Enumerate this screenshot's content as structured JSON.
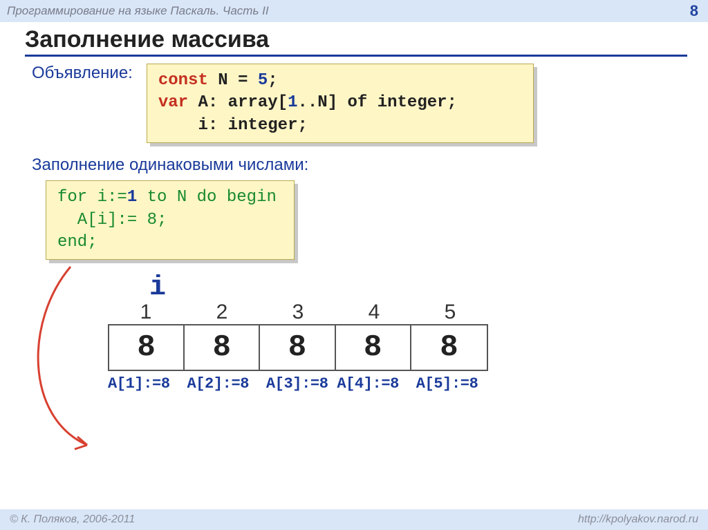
{
  "header": {
    "title": "Программирование на языке Паскаль. Часть II",
    "page": "8"
  },
  "title": "Заполнение массива",
  "section1_label": "Объявление:",
  "code1": {
    "l1a": "const",
    "l1b": " N = ",
    "l1c": "5",
    "l1d": ";",
    "l2a": "var",
    "l2b": " A: array[",
    "l2c": "1",
    "l2d": "..N] of integer;",
    "l3": "    i: integer;"
  },
  "section2_label": "Заполнение одинаковыми числами:",
  "code2": {
    "l1a": "for i:=",
    "l1b": "1",
    "l1c": " to N do begin",
    "l2": "  A[i]:= 8;",
    "l3": "end;"
  },
  "diagram": {
    "index_var": "i",
    "indices": [
      "1",
      "2",
      "3",
      "4",
      "5"
    ],
    "values": [
      "8",
      "8",
      "8",
      "8",
      "8"
    ],
    "assigns": [
      "A[1]:=8",
      "A[2]:=8",
      "A[3]:=8",
      "A[4]:=8",
      "A[5]:=8"
    ]
  },
  "footer": {
    "left": "© К. Поляков, 2006-2011",
    "right": "http://kpolyakov.narod.ru"
  }
}
